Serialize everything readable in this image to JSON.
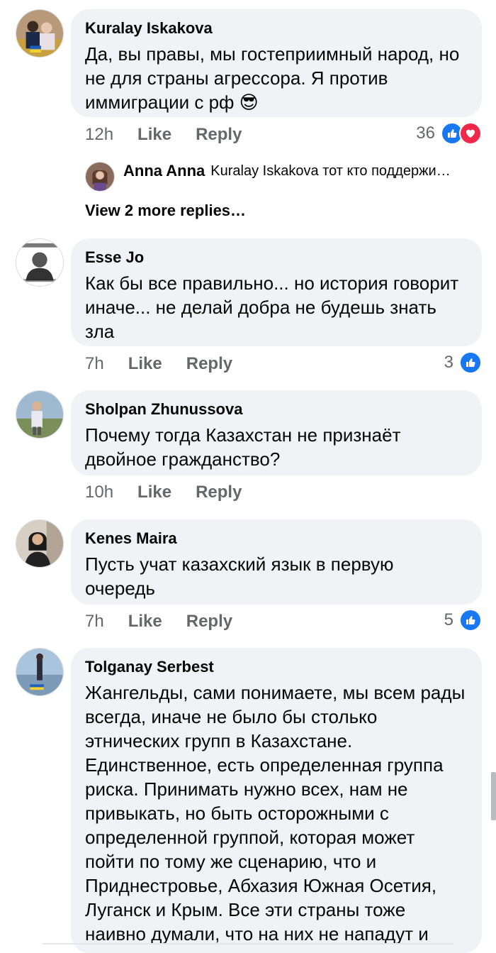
{
  "comments": [
    {
      "author": "Kuralay Iskakova",
      "text": "Да, вы правы, мы гостеприимный народ, но не для страны агрессора. Я против иммиграции с рф 😎",
      "time": "12h",
      "like_label": "Like",
      "reply_label": "Reply",
      "reaction_count": "36",
      "reaction_icons": [
        "like-icon",
        "love-icon"
      ],
      "reply_preview": {
        "author": "Anna Anna",
        "text": "Kuralay Iskakova  тот кто поддержи…"
      },
      "more_replies": "View 2 more replies…"
    },
    {
      "author": "Esse Jo",
      "text": "Как бы все правильно... но история говорит иначе... не делай добра не будешь знать зла",
      "time": "7h",
      "like_label": "Like",
      "reply_label": "Reply",
      "reaction_count": "3",
      "reaction_icons": [
        "like-icon"
      ]
    },
    {
      "author": "Sholpan  Zhunussova",
      "text": "Почему тогда Казахстан не признаёт двойное гражданство?",
      "time": "10h",
      "like_label": "Like",
      "reply_label": "Reply"
    },
    {
      "author": "Kenes Maira",
      "text": "Пусть учат казахский язык в первую очередь",
      "time": "7h",
      "like_label": "Like",
      "reply_label": "Reply",
      "reaction_count": "5",
      "reaction_icons": [
        "like-icon"
      ]
    },
    {
      "author": "Tolganay Serbest",
      "text": "Жангельды, сами понимаете, мы всем рады всегда, иначе не было бы столько этнических групп в Казахстане. Единственное, есть определенная группа риска.  Принимать нужно всех, нам не привыкать, но быть осторожными с определенной группой, которая может пойти по тому же сценарию, что и Приднестровье, Абхазия Южная Осетия, Луганск и Крым.  Все эти страны тоже наивно думали, что на них не нападут и"
    }
  ],
  "colors": {
    "bubble": "#f0f2f5",
    "secondary_text": "#65676b",
    "like_blue": "#1877f2",
    "love_red": "#f02849"
  }
}
